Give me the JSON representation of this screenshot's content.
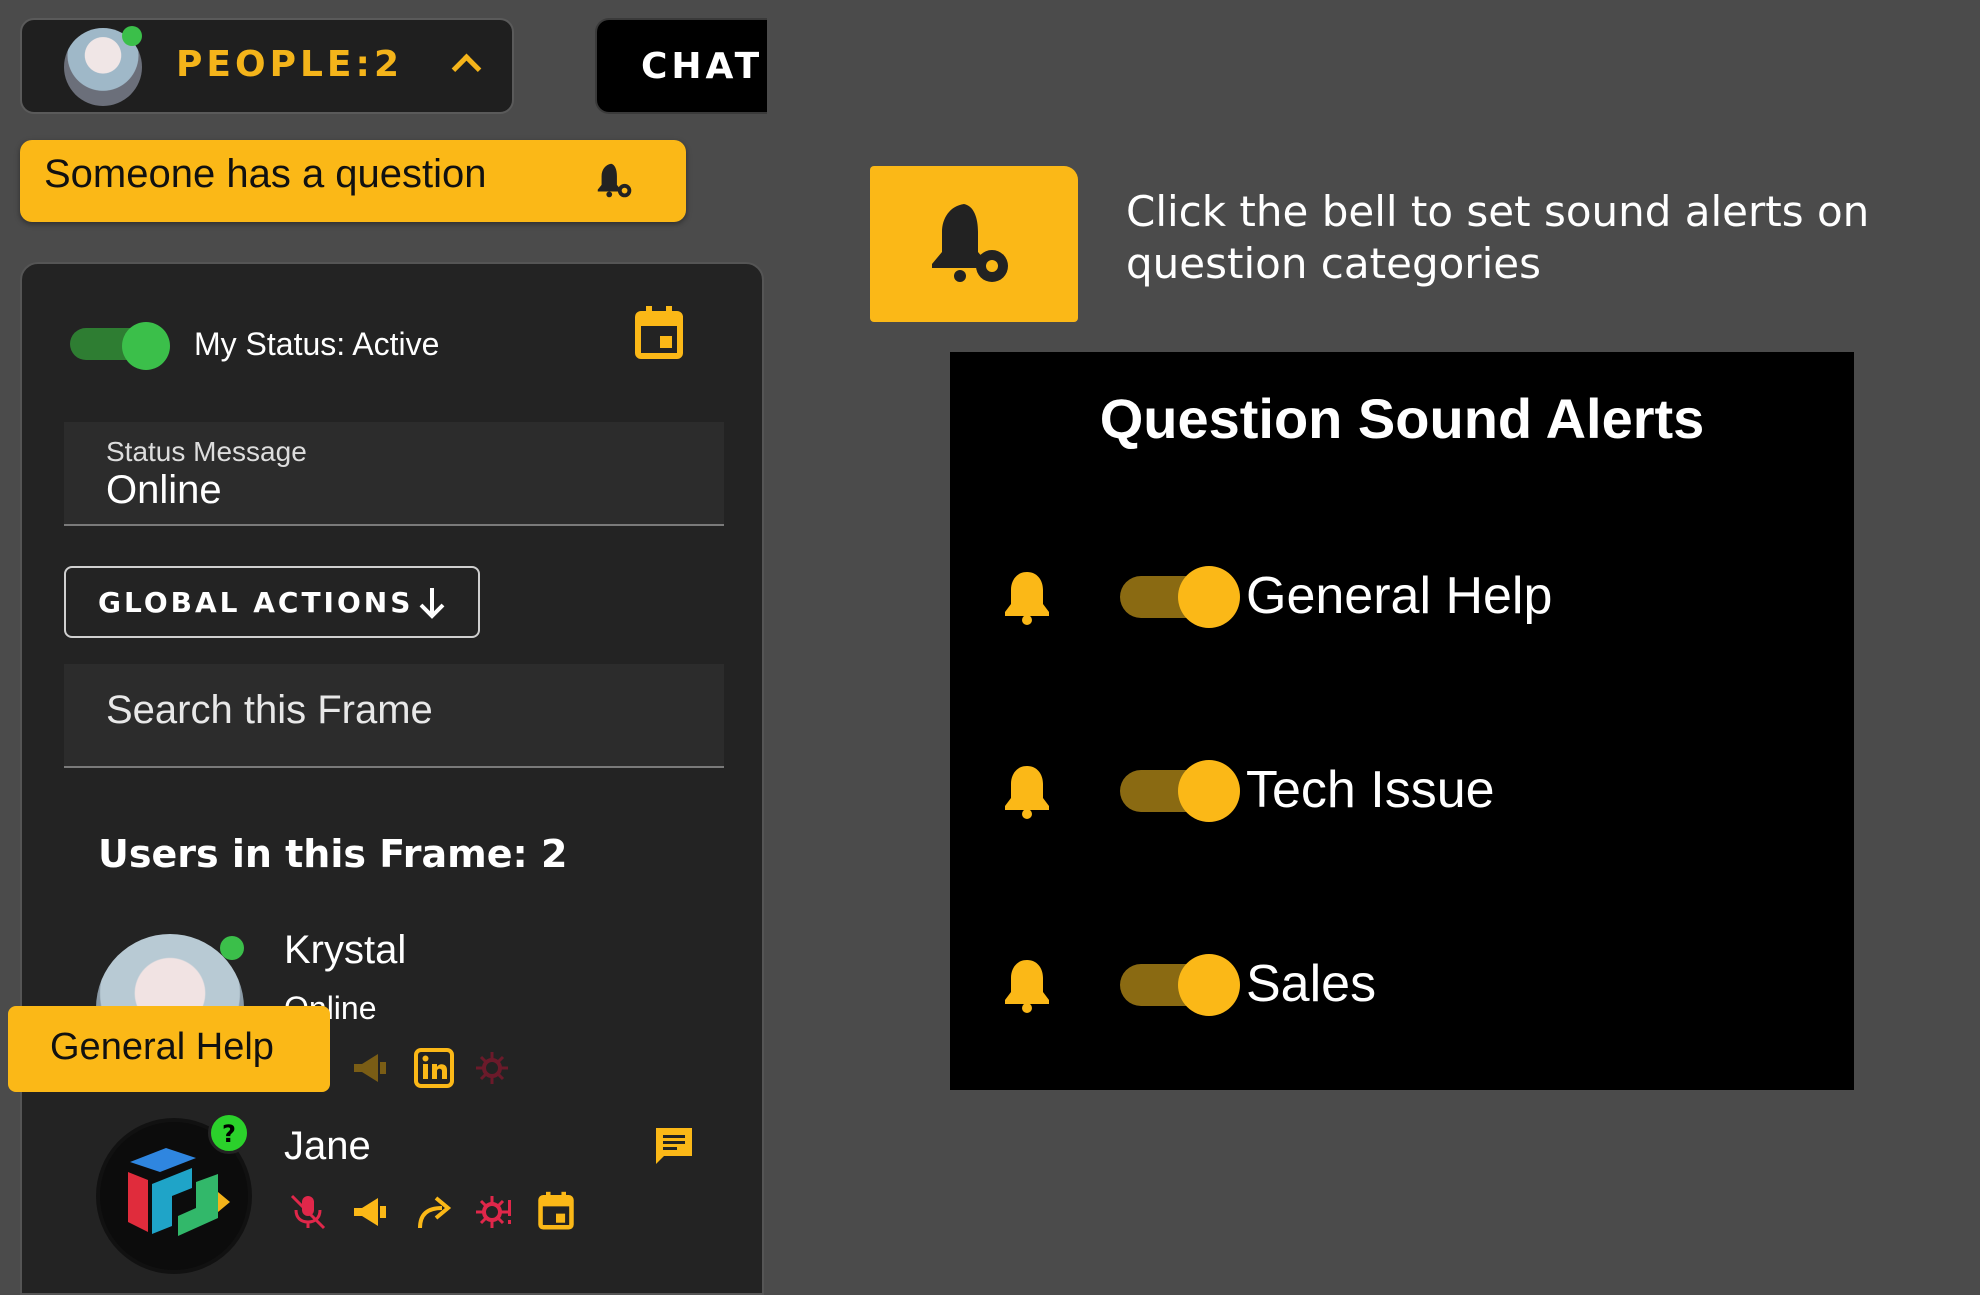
{
  "top_bar": {
    "people_label": "PEOPLE:",
    "people_count": "2",
    "chat_label": "CHAT"
  },
  "question_banner": {
    "text": "Someone has a question"
  },
  "panel": {
    "status_label": "My Status: Active",
    "status_message_label": "Status Message",
    "status_message_value": "Online",
    "global_actions_label": "GLOBAL ACTIONS",
    "search_placeholder": "Search this Frame",
    "users_title": "Users in this Frame: 2",
    "users": [
      {
        "name": "Krystal",
        "status": "Online",
        "tag": "General Help"
      },
      {
        "name": "Jane",
        "badge": "?"
      }
    ]
  },
  "hint": {
    "caption": "Click the bell to set sound alerts on question categories"
  },
  "alerts": {
    "title": "Question Sound Alerts",
    "items": [
      {
        "label": "General Help",
        "enabled": true
      },
      {
        "label": "Tech Issue",
        "enabled": true
      },
      {
        "label": "Sales",
        "enabled": true
      }
    ]
  },
  "colors": {
    "accent": "#fbb817",
    "active_green": "#3bbf4a",
    "danger": "#e0274a",
    "background": "#4b4b4b"
  }
}
